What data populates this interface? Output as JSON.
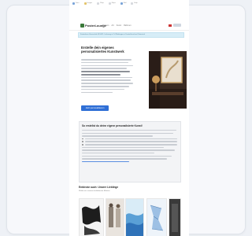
{
  "topbar": {
    "items": [
      {
        "label": "Docs",
        "icon": "doc-icon"
      },
      {
        "label": "Images",
        "icon": "image-icon"
      },
      {
        "label": "Shop",
        "icon": "cart-icon"
      },
      {
        "label": "Maps",
        "icon": "map-icon"
      },
      {
        "label": "Mail",
        "icon": "mail-icon"
      },
      {
        "label": "Help",
        "icon": "help-icon"
      }
    ]
  },
  "header": {
    "logo": "PosterLounge",
    "nav": [
      "Posters",
      "Art",
      "Kunst",
      "Rahmen"
    ],
    "sign_in": ""
  },
  "notice": {
    "text": "Kostenloser Versand ab 49 EUR - Lieferung in 2-4 Werktagen in Deutschland und Österreich"
  },
  "hero": {
    "title": "Erstelle dein eigenes personalisiertes Kunstwerk",
    "button": "Jetzt personalisieren"
  },
  "info": {
    "title": "So erstellst du deine eigene personalisierte Kunst!"
  },
  "recommendations": {
    "title": "Entdecke auch: Unsere Lieblinge",
    "subtitle": "Wähle aus unseren beliebtesten Motiven"
  },
  "colors": {
    "accent": "#2f6fd6",
    "notice_bg": "#d7edf7",
    "logo_green": "#3b7a3a"
  }
}
